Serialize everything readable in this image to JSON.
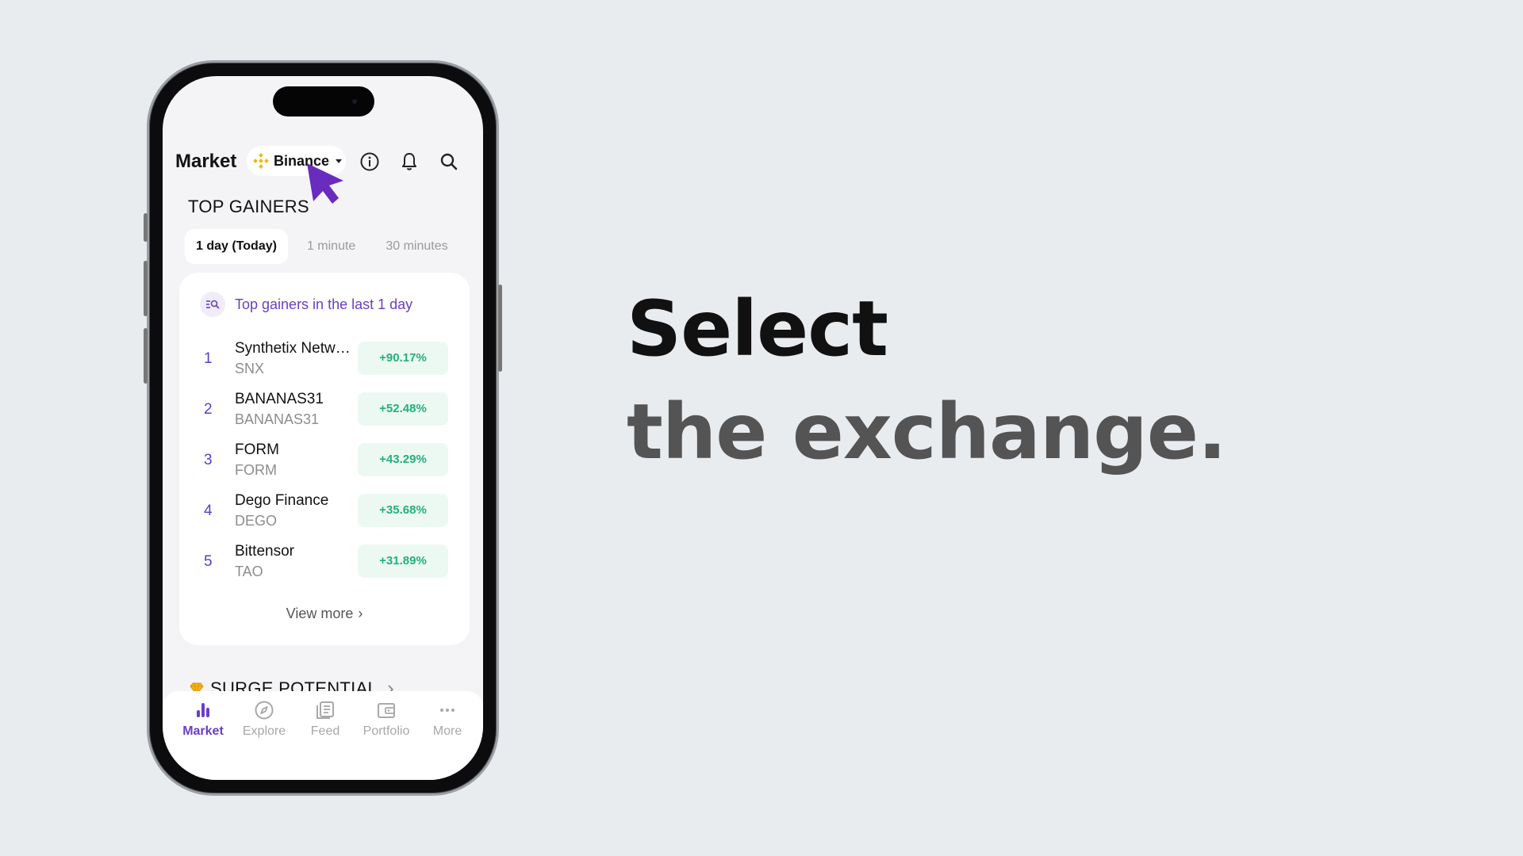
{
  "header": {
    "title": "Market",
    "exchange": "Binance"
  },
  "section": {
    "title": "TOP GAINERS"
  },
  "tabs": [
    {
      "label": "1 day (Today)",
      "active": true
    },
    {
      "label": "1 minute",
      "active": false
    },
    {
      "label": "30 minutes",
      "active": false
    }
  ],
  "card": {
    "heading": "Top gainers in the last 1 day",
    "rows": [
      {
        "rank": "1",
        "name": "Synthetix Network",
        "symbol": "SNX",
        "change": "+90.17%"
      },
      {
        "rank": "2",
        "name": "BANANAS31",
        "symbol": "BANANAS31",
        "change": "+52.48%"
      },
      {
        "rank": "3",
        "name": "FORM",
        "symbol": "FORM",
        "change": "+43.29%"
      },
      {
        "rank": "4",
        "name": "Dego Finance",
        "symbol": "DEGO",
        "change": "+35.68%"
      },
      {
        "rank": "5",
        "name": "Bittensor",
        "symbol": "TAO",
        "change": "+31.89%"
      }
    ],
    "view_more": "View more"
  },
  "surge": {
    "title": "SURGE POTENTIAL"
  },
  "nav": [
    {
      "label": "Market",
      "icon": "bar-chart-icon",
      "active": true
    },
    {
      "label": "Explore",
      "icon": "compass-icon",
      "active": false
    },
    {
      "label": "Feed",
      "icon": "feed-icon",
      "active": false
    },
    {
      "label": "Portfolio",
      "icon": "wallet-icon",
      "active": false
    },
    {
      "label": "More",
      "icon": "more-dots-icon",
      "active": false
    }
  ],
  "headline": {
    "line1": "Select",
    "line2": "the exchange."
  },
  "colors": {
    "accent": "#6a3fc2",
    "positive": "#23b07a",
    "positive_bg": "#ecf9f3",
    "binance": "#f0b90b",
    "background": "#e9ecef"
  }
}
